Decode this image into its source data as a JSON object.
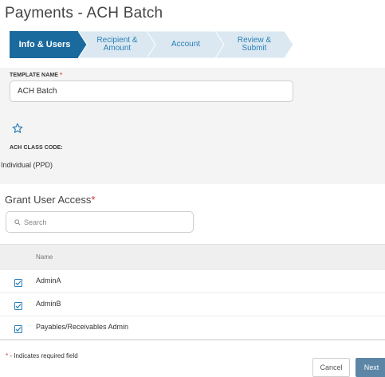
{
  "page": {
    "title": "Payments - ACH Batch"
  },
  "wizard": {
    "steps": [
      {
        "label": "Info & Users",
        "active": true
      },
      {
        "label": "Recipient &\nAmount",
        "active": false
      },
      {
        "label": "Account",
        "active": false
      },
      {
        "label": "Review &\nSubmit",
        "active": false
      }
    ],
    "colors": {
      "active": "#1b6a9e",
      "inactive": "#dbe8f1",
      "inactive_text": "#2a7fb8"
    }
  },
  "form": {
    "template_name_label": "TEMPLATE NAME",
    "required_mark": "*",
    "template_name_value": "ACH Batch",
    "favorite_icon": "star-outline-icon",
    "ach_class_label": "ACH CLASS CODE:",
    "ach_class_value": "Individual (PPD)"
  },
  "access": {
    "title": "Grant User Access",
    "required_mark": "*",
    "search_placeholder": "Search",
    "column_name": "Name",
    "users": [
      {
        "name": "AdminA",
        "checked": true
      },
      {
        "name": "AdminB",
        "checked": true
      },
      {
        "name": "Payables/Receivables Admin",
        "checked": true
      }
    ]
  },
  "footer": {
    "required_mark": "*",
    "required_note": " - Indicates required field",
    "cancel_label": "Cancel",
    "next_label": "Next"
  }
}
